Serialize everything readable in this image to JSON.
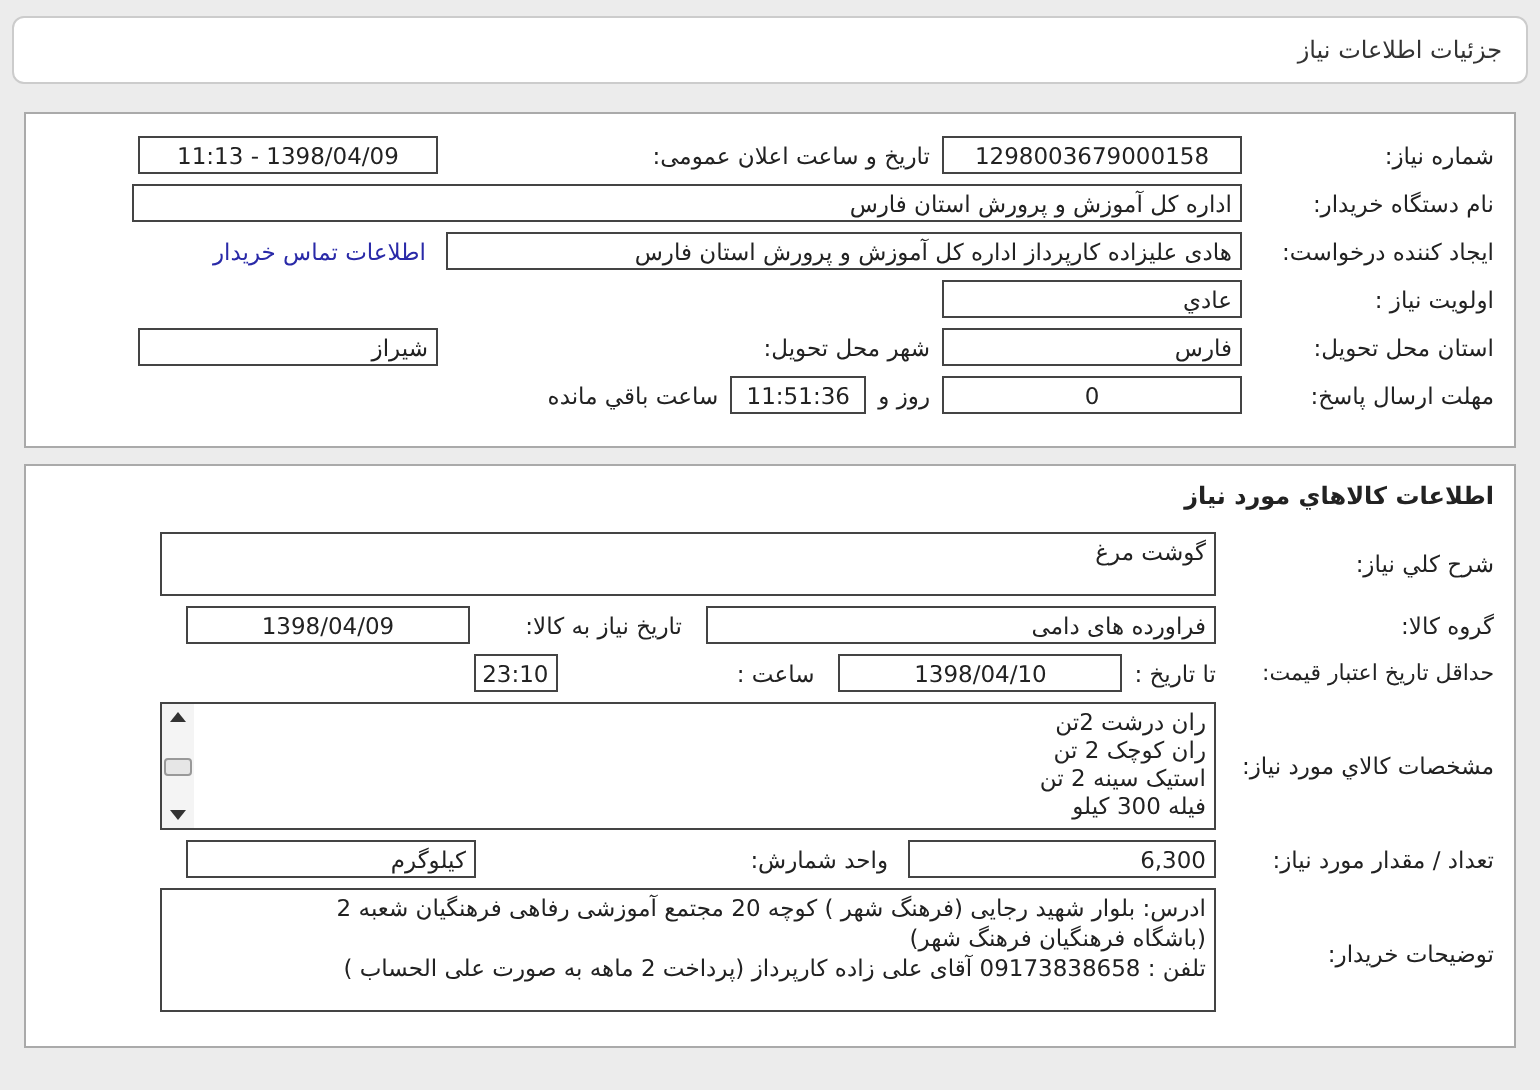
{
  "page_title": "جزئیات اطلاعات نیاز",
  "need_info": {
    "need_number": {
      "label": "شماره نیاز:",
      "value": "1298003679000158"
    },
    "announce_datetime": {
      "label": "تاریخ و ساعت اعلان عمومی:",
      "value": "1398/04/09 - 11:13"
    },
    "buyer_org": {
      "label": "نام دستگاه خریدار:",
      "value": "اداره کل آموزش و پرورش استان فارس"
    },
    "requester": {
      "label": "ایجاد کننده درخواست:",
      "value": "هادی علیزاده کارپرداز اداره کل آموزش و پرورش استان فارس",
      "link": "اطلاعات تماس خریدار"
    },
    "priority": {
      "label": "اولویت نیاز :",
      "value": "عادي"
    },
    "delivery_province": {
      "label": "استان محل تحویل:",
      "value": "فارس"
    },
    "delivery_city": {
      "label": "شهر محل تحویل:",
      "value": "شیراز"
    },
    "deadline": {
      "label": "مهلت ارسال پاسخ:",
      "days": "0",
      "days_label": "روز و",
      "time": "11:51:36",
      "time_label": "ساعت باقي مانده"
    }
  },
  "goods_info": {
    "heading": "اطلاعات کالاهاي مورد نیاز",
    "description": {
      "label": "شرح کلي نیاز:",
      "value": "گوشت مرغ"
    },
    "goods_group": {
      "label": "گروه کالا:",
      "value": "فراورده های دامی"
    },
    "need_date": {
      "label": "تاریخ نیاز به کالا:",
      "value": "1398/04/09"
    },
    "price_validity": {
      "label": "حداقل تاریخ اعتبار قیمت:",
      "to_date_label": "تا تاریخ :",
      "date": "1398/04/10",
      "time_label": "ساعت :",
      "time": "23:10"
    },
    "specs": {
      "label": "مشخصات کالاي مورد نیاز:",
      "lines": [
        "ران درشت  2تن",
        "ران کوچک 2 تن",
        "استیک سینه 2 تن",
        "فیله 300 کیلو"
      ]
    },
    "quantity": {
      "label": "تعداد / مقدار مورد نیاز:",
      "value": "6,300"
    },
    "unit": {
      "label": "واحد شمارش:",
      "value": "کیلوگرم"
    },
    "buyer_notes": {
      "label": "توضیحات خریدار:",
      "lines": [
        "ادرس: بلوار شهید رجایی (فرهنگ شهر ) کوچه 20  مجتمع آموزشی رفاهی فرهنگیان شعبه 2",
        "(باشگاه فرهنگیان فرهنگ شهر)",
        "تلفن : 09173838658 آقای علی زاده کارپرداز (پرداخت 2 ماهه به صورت علی الحساب )"
      ]
    }
  }
}
